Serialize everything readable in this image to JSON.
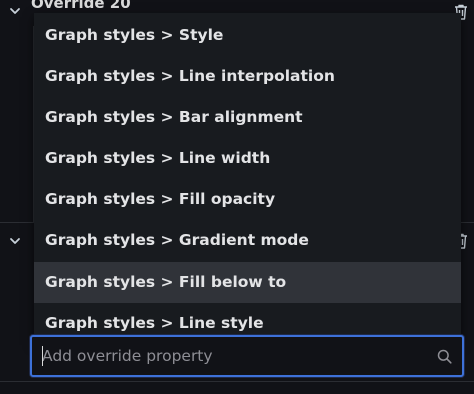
{
  "override": {
    "title": "Override 20"
  },
  "menu": {
    "items": [
      {
        "label": "Graph styles > Style"
      },
      {
        "label": "Graph styles > Line interpolation"
      },
      {
        "label": "Graph styles > Bar alignment"
      },
      {
        "label": "Graph styles > Line width"
      },
      {
        "label": "Graph styles > Fill opacity"
      },
      {
        "label": "Graph styles > Gradient mode"
      },
      {
        "label": "Graph styles > Fill below to"
      },
      {
        "label": "Graph styles > Line style"
      }
    ],
    "highlighted_item": "Graph styles > Fill below to"
  },
  "search": {
    "placeholder": "Add override property",
    "value": ""
  },
  "colors": {
    "background": "#111217",
    "menu_background": "#181b1f",
    "highlight": "#303339",
    "focus_border": "#3d71d9",
    "text": "#e3e4e6"
  },
  "icons": [
    "chevron-down-icon",
    "trash-icon",
    "search-icon"
  ]
}
